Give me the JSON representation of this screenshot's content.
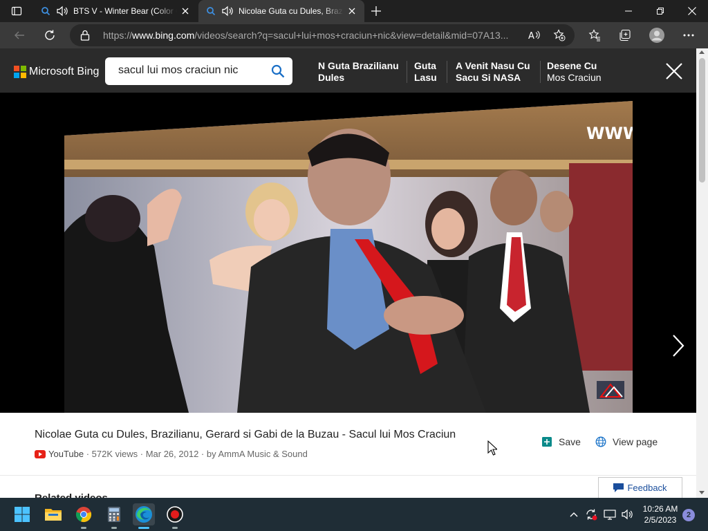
{
  "browser": {
    "tabs": [
      {
        "title": "BTS V - Winter Bear (Color Coded Lyrics)",
        "favicon": "search-icon",
        "audio": true,
        "active": false
      },
      {
        "title": "Nicolae Guta cu Dules, Brazilianu",
        "favicon": "search-icon",
        "audio": true,
        "active": true
      }
    ],
    "url_prefix": "https://",
    "url_host": "www.bing.com",
    "url_rest": "/videos/search?q=sacul+lui+mos+craciun+nic&view=detail&mid=07A13..."
  },
  "bing": {
    "brand": "Microsoft Bing",
    "search_value": "sacul lui mos craciun nic",
    "related_searches": [
      {
        "line1": "N Guta Brazilianu",
        "line2": "Dules",
        "bold2": true
      },
      {
        "line1": "Guta",
        "line2": "Lasu",
        "bold2": true
      },
      {
        "line1": "A Venit Nasu Cu",
        "line2": "Sacu Si NASA",
        "bold2": true
      },
      {
        "line1": "Desene Cu",
        "line2": "Mos Craciun",
        "bold2": false
      }
    ]
  },
  "video": {
    "watermark": "WWW",
    "logo_text": "AmmA",
    "title": "Nicolae Guta cu Dules, Brazilianu, Gerard si Gabi de la Buzau - Sacul lui Mos Craciun",
    "source": "YouTube",
    "views": "572K views",
    "date": "Mar 26, 2012",
    "channel": "by AmmA Music & Sound",
    "save_label": "Save",
    "view_page_label": "View page",
    "related_label": "Related videos",
    "feedback_label": "Feedback"
  },
  "taskbar": {
    "apps": [
      "windows-start-icon",
      "file-explorer-icon",
      "chrome-icon",
      "calculator-icon",
      "edge-icon",
      "recorder-icon"
    ],
    "time": "10:26 AM",
    "date": "2/5/2023",
    "notifications": "2"
  },
  "colors": {
    "bing_header": "#2b2b2b",
    "tabstrip": "#202020",
    "taskbar": "#1f2d36",
    "accent_blue": "#0078d4",
    "feedback_blue": "#1a4e9c"
  }
}
